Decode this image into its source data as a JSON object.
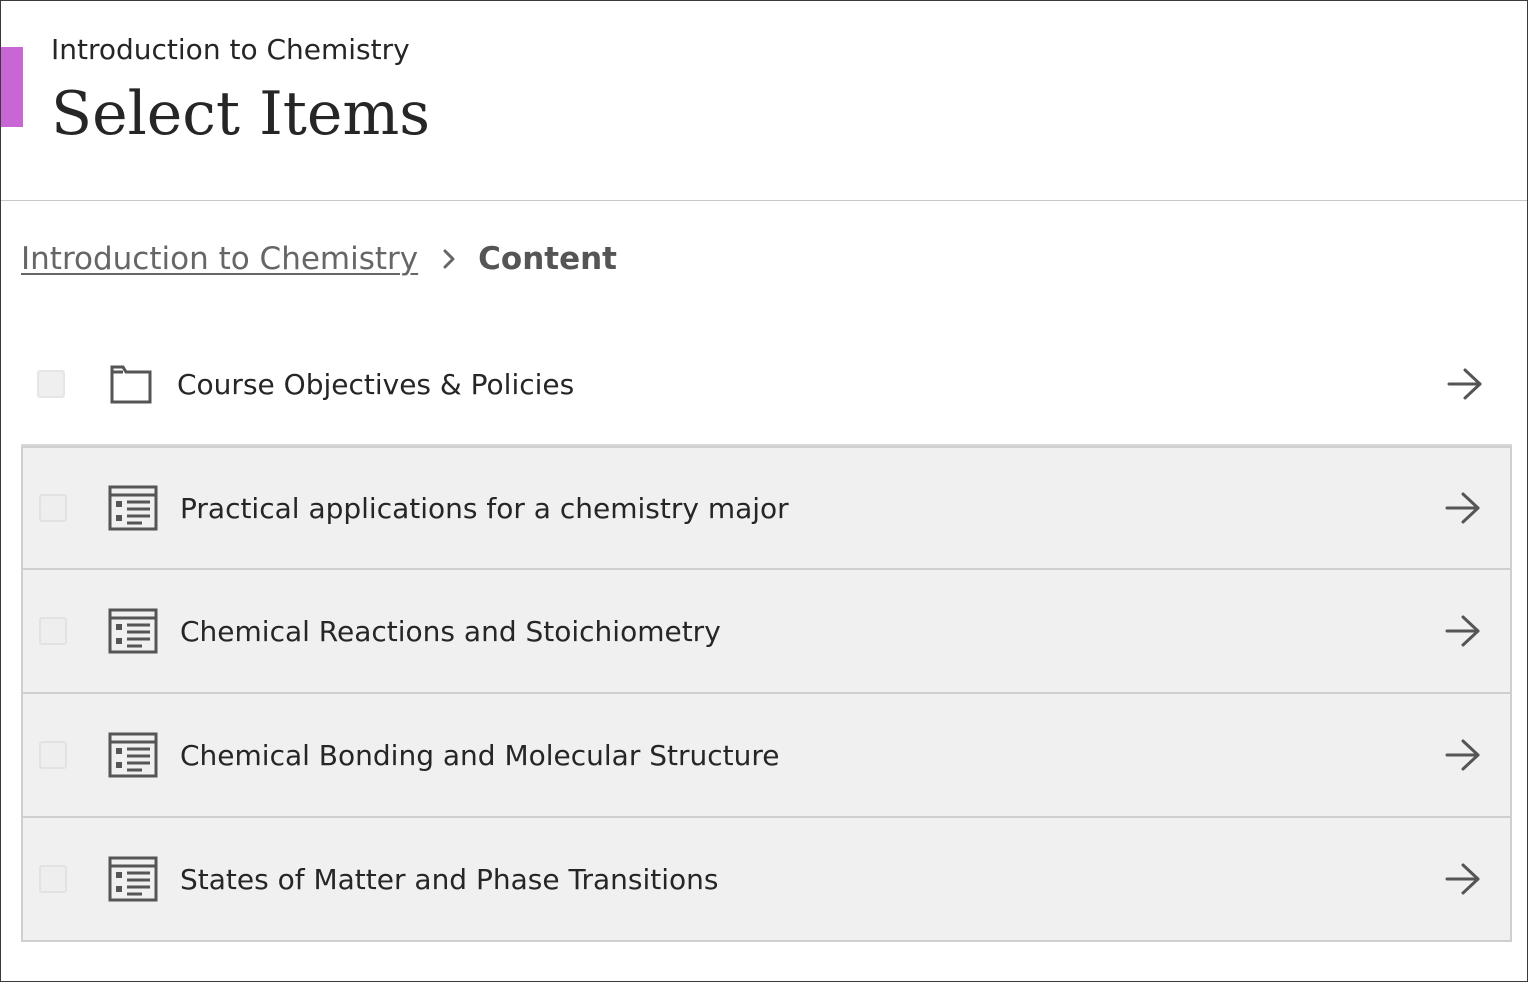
{
  "header": {
    "course_name": "Introduction to Chemistry",
    "title": "Select Items",
    "accent_color": "#c866d6"
  },
  "breadcrumb": {
    "parent_label": "Introduction to Chemistry",
    "current_label": "Content"
  },
  "items": [
    {
      "label": "Course Objectives & Policies",
      "icon": "folder-icon"
    },
    {
      "label": "Practical applications for a chemistry major",
      "icon": "document-icon"
    },
    {
      "label": "Chemical Reactions and Stoichiometry",
      "icon": "document-icon"
    },
    {
      "label": "Chemical Bonding and Molecular Structure",
      "icon": "document-icon"
    },
    {
      "label": "States of Matter and Phase Transitions",
      "icon": "document-icon"
    }
  ]
}
